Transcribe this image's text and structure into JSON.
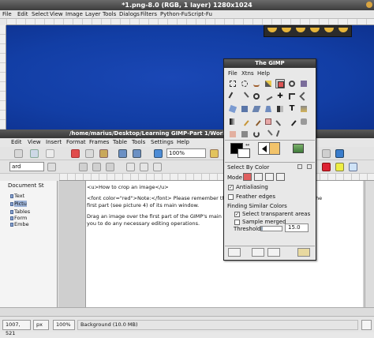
{
  "gimp_image_window": {
    "title": "*1.png-8.0 (RGB, 1 layer) 1280x1024",
    "menu": [
      "File",
      "Edit",
      "Select",
      "View",
      "Image",
      "Layer",
      "Tools",
      "Dialogs",
      "Filters",
      "Python-Fu",
      "Script-Fu"
    ]
  },
  "writer_window": {
    "title": "/home/marius/Desktop/Learning GIMP-Part 1/Working With GIMP.od",
    "menu": [
      "Edit",
      "View",
      "Insert",
      "Format",
      "Frames",
      "Table",
      "Tools",
      "Settings",
      "Help"
    ],
    "style_combo": "ard",
    "zoom_combo": "100%",
    "navigator": {
      "header": "Document St",
      "items": [
        "Text",
        "Pictu",
        "Tables",
        "Form",
        "Embe"
      ]
    },
    "doc_lines": [
      "<u>How to crop an image</u>",
      "<font color=\"red\">Note:</font> Please remember the fact tl",
      "first part (see picture 4) of its main window.",
      "Drag an image over the first part of the GIMP's main window (",
      "you to do any necessary editing operations."
    ],
    "doc_right_fragment": "he"
  },
  "toolbox": {
    "title": "The GIMP",
    "menu": [
      "File",
      "Xtns",
      "Help"
    ],
    "options_title": "Select By Color",
    "mode_label": "Mode:",
    "antialiasing": {
      "label": "Antialiasing",
      "checked": true
    },
    "feather_edges": {
      "label": "Feather edges",
      "checked": false
    },
    "finding_label": "Finding Similar Colors",
    "select_transparent": {
      "label": "Select transparent areas",
      "checked": true
    },
    "sample_merged": {
      "label": "Sample merged",
      "checked": false
    },
    "threshold": {
      "label": "Threshold:",
      "value": "15.0",
      "fraction": 0.06
    }
  },
  "status_bar": {
    "coords": "1007, 521",
    "unit": "px",
    "zoom": "100%",
    "info": "Background (10.0 MB)"
  },
  "colors": {
    "canvas": "#123ea5",
    "fg": "#000000",
    "bg": "#ffffff",
    "brush_pattern": "#f2c36a"
  }
}
